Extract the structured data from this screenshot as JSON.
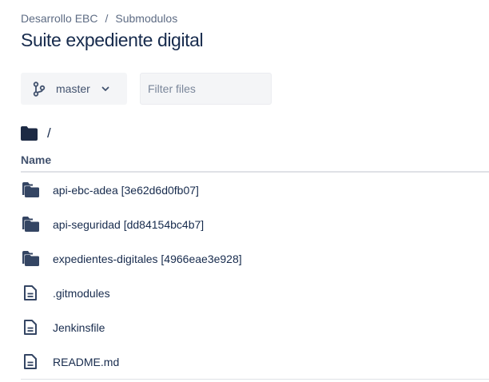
{
  "breadcrumb": {
    "project": "Desarrollo EBC",
    "separator": "/",
    "repo": "Submodulos"
  },
  "page_title": "Suite expediente digital",
  "toolbar": {
    "branch_label": "master",
    "branch_icon": "branch-icon",
    "filter_placeholder": "Filter files"
  },
  "path": {
    "current": "/",
    "icon": "folder-icon"
  },
  "table": {
    "column_name": "Name"
  },
  "files": [
    {
      "name": "api-ebc-adea [3e62d6d0fb07]",
      "type": "submodule",
      "icon": "folder-icon"
    },
    {
      "name": "api-seguridad [dd84154bc4b7]",
      "type": "submodule",
      "icon": "folder-icon"
    },
    {
      "name": "expedientes-digitales [4966eae3e928]",
      "type": "submodule",
      "icon": "folder-icon"
    },
    {
      "name": ".gitmodules",
      "type": "file",
      "icon": "file-icon"
    },
    {
      "name": "Jenkinsfile",
      "type": "file",
      "icon": "file-icon"
    },
    {
      "name": "README.md",
      "type": "file",
      "icon": "file-icon"
    }
  ],
  "colors": {
    "text_primary": "#172b4d",
    "text_secondary": "#5e6c84",
    "icon_dark": "#344563",
    "button_bg": "#f4f5f7",
    "divider": "#dfe1e6"
  }
}
